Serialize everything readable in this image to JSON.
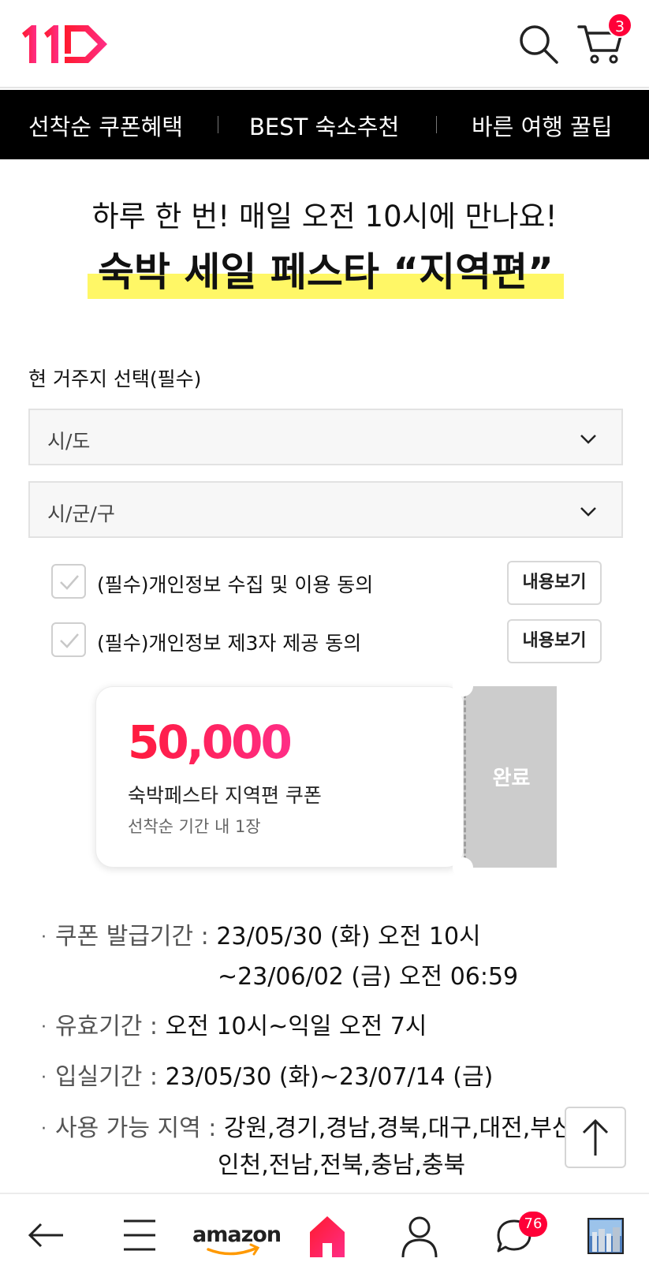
{
  "header": {
    "logo_text": "11",
    "search_icon": "search-icon",
    "cart_icon": "cart-icon",
    "cart_count": "3"
  },
  "topnav": {
    "tabs": [
      "선착순 쿠폰혜택",
      "BEST 숙소추천",
      "바른 여행 꿀팁"
    ]
  },
  "promo": {
    "subtitle": "하루 한 번! 매일 오전 10시에 만나요!",
    "title": "숙박 세일 페스타 “지역편”",
    "highlight_color": "#fff766"
  },
  "form": {
    "section_label": "현 거주지 선택(필수)",
    "province_select": "시/도",
    "district_select": "시/군/구"
  },
  "agreements": [
    {
      "label": "(필수)개인정보 수집 및 이용 동의",
      "checked": true,
      "button": "내용보기"
    },
    {
      "label": "(필수)개인정보 제3자 제공 동의",
      "checked": true,
      "button": "내용보기"
    }
  ],
  "coupon": {
    "amount": "50,000",
    "name": "숙박페스타 지역편 쿠폰",
    "note": "선착순 기간 내 1장",
    "status": "완료"
  },
  "info": {
    "issue_period_key": "쿠폰 발급기간 : ",
    "issue_period_val": "23/05/30 (화) 오전 10시",
    "issue_period_cont": "~23/06/02 (금) 오전 06:59",
    "valid_key": "유효기간 : ",
    "valid_val": "오전 10시~익일 오전 7시",
    "checkin_key": "입실기간 : ",
    "checkin_val": "23/05/30 (화)~23/07/14 (금)",
    "region_key": "사용 가능 지역 : ",
    "region_val": "강원,경기,경남,경북,대구,대전,부산,",
    "region_cont": "인천,전남,전북,충남,충북"
  },
  "bottom_bar": {
    "back_icon": "back-arrow-icon",
    "menu_icon": "menu-icon",
    "amazon_label": "amazon",
    "home_icon": "home-icon",
    "profile_icon": "profile-icon",
    "chat_icon": "chat-icon",
    "chat_count": "76",
    "recent_icon": "recent-view-thumbnail"
  },
  "colors": {
    "brand": "#ff0038",
    "brand_gradient_end": "#ff2d86",
    "nav_bg": "#000000",
    "stub_bg": "#cccccc"
  }
}
